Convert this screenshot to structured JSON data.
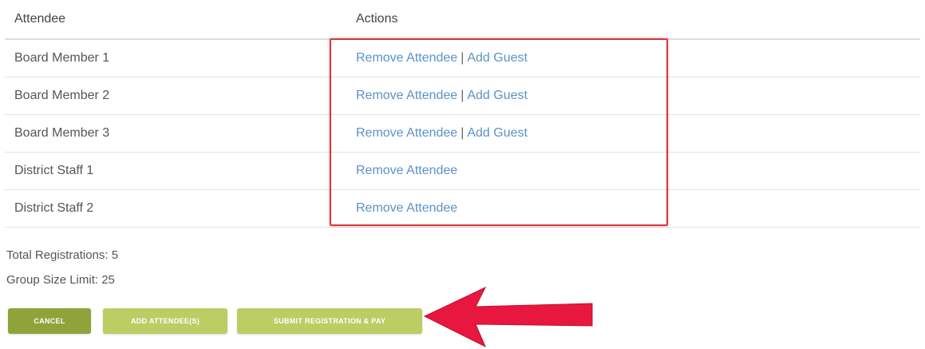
{
  "table": {
    "headers": {
      "attendee": "Attendee",
      "actions": "Actions"
    },
    "rows": [
      {
        "name": "Board Member 1",
        "remove": "Remove Attendee",
        "sep": "|",
        "add_guest": "Add Guest"
      },
      {
        "name": "Board Member 2",
        "remove": "Remove Attendee",
        "sep": "|",
        "add_guest": "Add Guest"
      },
      {
        "name": "Board Member 3",
        "remove": "Remove Attendee",
        "sep": "|",
        "add_guest": "Add Guest"
      },
      {
        "name": "District Staff 1",
        "remove": "Remove Attendee"
      },
      {
        "name": "District Staff 2",
        "remove": "Remove Attendee"
      }
    ]
  },
  "summary": {
    "total_registrations": "Total Registrations: 5",
    "group_size_limit": "Group Size Limit: 25"
  },
  "buttons": {
    "cancel": "CANCEL",
    "add_attendees": "ADD ATTENDEE(S)",
    "submit": "SUBMIT REGISTRATION & PAY"
  },
  "annotations": {
    "highlight_color": "#d9363e",
    "arrow_color": "#e8173f",
    "arrow_icon": "left-arrow-icon"
  },
  "colors": {
    "link": "#5b93c7",
    "button_primary": "#8ea43b",
    "button_secondary": "#bccd64"
  }
}
